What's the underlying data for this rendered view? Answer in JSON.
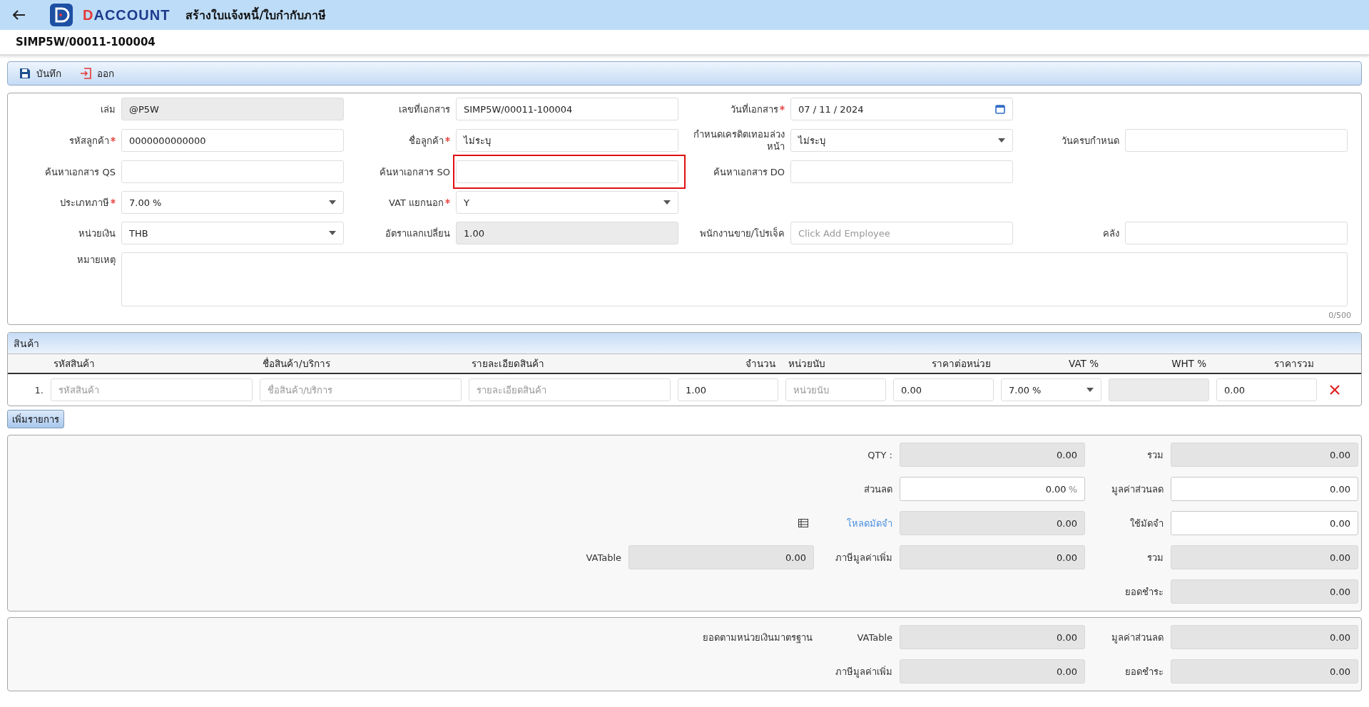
{
  "header": {
    "logo_text": "DACCOUNT",
    "title": "สร้างใบแจ้งหนี้/ใบกำกับภาษี"
  },
  "document_number": "SIMP5W/00011-100004",
  "toolbar": [
    {
      "kind": "save",
      "label": "บันทึก"
    },
    {
      "kind": "exit",
      "label": "ออก"
    }
  ],
  "form": {
    "rows": [
      [
        {
          "label": "เล่ม",
          "required": false,
          "kind": "text",
          "value": "@P5W",
          "disabled": true,
          "highlighted": false
        },
        {
          "label": "เลขที่เอกสาร",
          "required": false,
          "kind": "text",
          "value": "SIMP5W/00011-100004",
          "disabled": false,
          "highlighted": false
        },
        {
          "label": "วันที่เอกสาร",
          "required": true,
          "kind": "date",
          "value": "07 / 11 /  2024",
          "disabled": false,
          "highlighted": false
        }
      ],
      [
        {
          "label": "รหัสลูกค้า",
          "required": true,
          "kind": "text",
          "value": "0000000000000",
          "disabled": false,
          "highlighted": false
        },
        {
          "label": "ชื่อลูกค้า",
          "required": true,
          "kind": "text",
          "value": "ไม่ระบุ",
          "disabled": false,
          "highlighted": false
        },
        {
          "label": "กำหนดเครดิตเทอมล่วงหน้า",
          "required": false,
          "kind": "select",
          "value": "ไม่ระบุ",
          "disabled": false,
          "highlighted": false
        },
        {
          "label": "วันครบกำหนด",
          "required": false,
          "kind": "text",
          "disabled": false,
          "highlighted": false
        }
      ],
      [
        {
          "label": "ค้นหาเอกสาร QS",
          "required": false,
          "kind": "text",
          "disabled": false,
          "highlighted": false
        },
        {
          "label": "ค้นหาเอกสาร SO",
          "required": false,
          "kind": "text",
          "disabled": false,
          "highlighted": true
        },
        {
          "label": "ค้นหาเอกสาร DO",
          "required": false,
          "kind": "text",
          "disabled": false,
          "highlighted": false
        }
      ],
      [
        {
          "label": "ประเภทภาษี",
          "required": true,
          "kind": "select",
          "value": "7.00 %",
          "disabled": false,
          "highlighted": false
        },
        {
          "label": "VAT แยกนอก",
          "required": true,
          "kind": "select",
          "value": "Y",
          "disabled": false,
          "highlighted": false
        }
      ],
      [
        {
          "label": "หน่วยเงิน",
          "required": false,
          "kind": "select",
          "value": "THB",
          "disabled": false,
          "highlighted": false
        },
        {
          "label": "อัตราแลกเปลี่ยน",
          "required": false,
          "kind": "text",
          "value": "1.00",
          "disabled": true,
          "highlighted": false
        },
        {
          "label": "พนักงานขาย/โปรเจ็ค",
          "required": false,
          "kind": "text",
          "placeholder": "Click Add Employee",
          "disabled": false,
          "highlighted": false
        },
        {
          "label": "คลัง",
          "required": false,
          "kind": "text",
          "disabled": false,
          "highlighted": false
        }
      ]
    ],
    "remarks": {
      "label": "หมายเหตุ",
      "counter": "0/500"
    }
  },
  "products": {
    "title": "สินค้า",
    "columns": [
      {
        "label": "รหัสสินค้า",
        "kind": "text"
      },
      {
        "label": "ชื่อสินค้า/บริการ",
        "kind": "text"
      },
      {
        "label": "รายละเอียดสินค้า",
        "kind": "text"
      },
      {
        "label": "จำนวน",
        "kind": "number"
      },
      {
        "label": "หน่วยนับ",
        "kind": "text"
      },
      {
        "label": "ราคาต่อหน่วย",
        "kind": "number"
      },
      {
        "label": "VAT %",
        "kind": "number"
      },
      {
        "label": "WHT %",
        "kind": "number"
      },
      {
        "label": "ราคารวม",
        "kind": "number"
      }
    ],
    "rows": [
      {
        "number": "1.",
        "cells": [
          {
            "kind": "text",
            "placeholder": "รหัสสินค้า",
            "disabled": false
          },
          {
            "kind": "text",
            "placeholder": "ชื่อสินค้า/บริการ",
            "disabled": false
          },
          {
            "kind": "text",
            "placeholder": "รายละเอียดสินค้า",
            "disabled": false
          },
          {
            "kind": "number",
            "value": "1.00",
            "disabled": false
          },
          {
            "kind": "text",
            "placeholder": "หน่วยนับ",
            "disabled": false
          },
          {
            "kind": "number",
            "value": "0.00",
            "disabled": false
          },
          {
            "kind": "select",
            "value": "7.00 %",
            "disabled": false
          },
          {
            "kind": "number",
            "disabled": true
          },
          {
            "kind": "number",
            "value": "0.00",
            "disabled": false
          }
        ]
      }
    ],
    "add_button": "เพิ่มรายการ"
  },
  "totals": [
    {
      "middle": {
        "label": "QTY :",
        "value": "0.00",
        "readonly": true,
        "link": false
      },
      "right": {
        "label": "รวม",
        "value": "0.00",
        "readonly": true,
        "link": false
      }
    },
    {
      "middle": {
        "label": "ส่วนลด",
        "value": "0.00",
        "suffix": "%",
        "readonly": false,
        "link": false
      },
      "right": {
        "label": "มูลค่าส่วนลด",
        "value": "0.00",
        "readonly": false,
        "link": false
      }
    },
    {
      "middle": {
        "label": "โหลดมัดจำ",
        "value": "0.00",
        "readonly": true,
        "link": true
      },
      "right": {
        "label": "ใช้มัดจำ",
        "value": "0.00",
        "readonly": false,
        "link": false
      }
    },
    {
      "left": {
        "label": "VATable",
        "value": "0.00",
        "readonly": true,
        "link": false
      },
      "middle": {
        "label": "ภาษีมูลค่าเพิ่ม",
        "value": "0.00",
        "readonly": true,
        "link": false
      },
      "right": {
        "label": "รวม",
        "value": "0.00",
        "readonly": true,
        "link": false
      }
    },
    {
      "right": {
        "label": "ยอดชำระ",
        "value": "0.00",
        "readonly": true,
        "link": false
      }
    }
  ],
  "base_totals": {
    "caption": "ยอดตามหน่วยเงินมาตรฐาน",
    "rows": [
      {
        "middle": {
          "label": "VATable",
          "value": "0.00",
          "readonly": true,
          "link": false
        },
        "right": {
          "label": "มูลค่าส่วนลด",
          "value": "0.00",
          "readonly": true,
          "link": false
        }
      },
      {
        "middle": {
          "label": "ภาษีมูลค่าเพิ่ม",
          "value": "0.00",
          "readonly": true,
          "link": false
        },
        "right": {
          "label": "ยอดชำระ",
          "value": "0.00",
          "readonly": true,
          "link": false
        }
      }
    ]
  }
}
